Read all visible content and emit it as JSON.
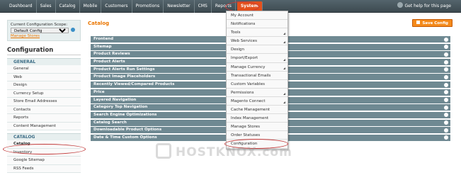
{
  "topnav": {
    "items": [
      "Dashboard",
      "Sales",
      "Catalog",
      "Mobile",
      "Customers",
      "Promotions",
      "Newsletter",
      "CMS",
      "Reports",
      "System"
    ],
    "active": "System",
    "help": "Get help for this page"
  },
  "sidebar": {
    "scope_label": "Current Configuration Scope:",
    "scope_value": "Default Config",
    "manage_stores": "Manage Stores",
    "title": "Configuration",
    "general_head": "GENERAL",
    "general_items": [
      "General",
      "Web",
      "Design",
      "Currency Setup",
      "Store Email Addresses",
      "Contacts",
      "Reports",
      "Content Management"
    ],
    "catalog_head": "CATALOG",
    "catalog_items": [
      "Catalog",
      "Inventory",
      "Google Sitemap",
      "RSS Feeds"
    ]
  },
  "main": {
    "title": "Catalog",
    "save_label": "Save Config",
    "sections": [
      "Frontend",
      "Sitemap",
      "Product Reviews",
      "Product Alerts",
      "Product Alerts Run Settings",
      "Product Image Placeholders",
      "Recently Viewed/Compared Products",
      "Price",
      "Layered Navigation",
      "Category Top Navigation",
      "Search Engine Optimizations",
      "Catalog Search",
      "Downloadable Product Options",
      "Date & Time Custom Options"
    ]
  },
  "dropdown": {
    "items": [
      "My Account",
      "Notifications",
      "Tools",
      "Web Services",
      "Design",
      "Import/Export",
      "Manage Currency",
      "Transactional Emails",
      "Custom Variables",
      "Permissions",
      "Magento Connect",
      "Cache Management",
      "Index Management",
      "Manage Stores",
      "Order Statuses",
      "Configuration"
    ]
  },
  "watermark": "HOSTKNOX.com",
  "colors": {
    "accent": "#ea7601",
    "topbar": "#4a575e",
    "section_bar": "#6f8992",
    "highlight": "#c23a3a"
  }
}
